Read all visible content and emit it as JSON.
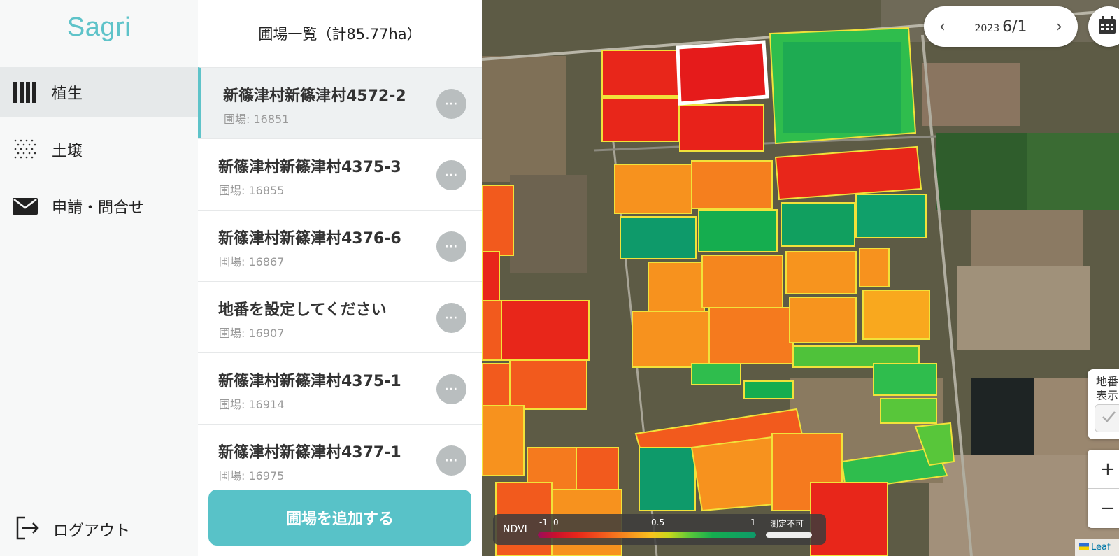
{
  "app": {
    "logo": "Sagri"
  },
  "sidebar": {
    "items": [
      {
        "label": "植生",
        "icon": "vegetation-icon",
        "active": true
      },
      {
        "label": "土壌",
        "icon": "soil-icon",
        "active": false
      },
      {
        "label": "申請・問合せ",
        "icon": "mail-icon",
        "active": false
      }
    ],
    "logout": {
      "label": "ログアウト",
      "icon": "logout-icon"
    }
  },
  "panel": {
    "title": "圃場一覧（計85.77ha）",
    "fields": [
      {
        "name": "新篠津村新篠津村4572-2",
        "id": "圃場: 16851",
        "selected": true
      },
      {
        "name": "新篠津村新篠津村4375-3",
        "id": "圃場: 16855",
        "selected": false
      },
      {
        "name": "新篠津村新篠津村4376-6",
        "id": "圃場: 16867",
        "selected": false
      },
      {
        "name": "地番を設定してください",
        "id": "圃場: 16907",
        "selected": false
      },
      {
        "name": "新篠津村新篠津村4375-1",
        "id": "圃場: 16914",
        "selected": false
      },
      {
        "name": "新篠津村新篠津村4377-1",
        "id": "圃場: 16975",
        "selected": false
      }
    ],
    "more_label": "···",
    "add_button": "圃場を追加する"
  },
  "map": {
    "date": {
      "year": "2023",
      "month_day": "6/1",
      "prev_icon": "chevron-left-icon",
      "next_icon": "chevron-right-icon"
    },
    "calendar_icon": "calendar-icon",
    "chiban": {
      "label_line1": "地番",
      "label_line2": "表示"
    },
    "zoom": {
      "in": "+",
      "out": "−"
    },
    "legend": {
      "label": "NDVI",
      "ticks": [
        "-1",
        "0",
        "0.5",
        "1"
      ],
      "na_label": "測定不可"
    },
    "attribution": "Leaf",
    "colors": {
      "accent": "#5ec3c9",
      "ndvi_low": "#c8102e",
      "ndvi_mid": "#f7921e",
      "ndvi_high": "#15ad4f"
    }
  }
}
